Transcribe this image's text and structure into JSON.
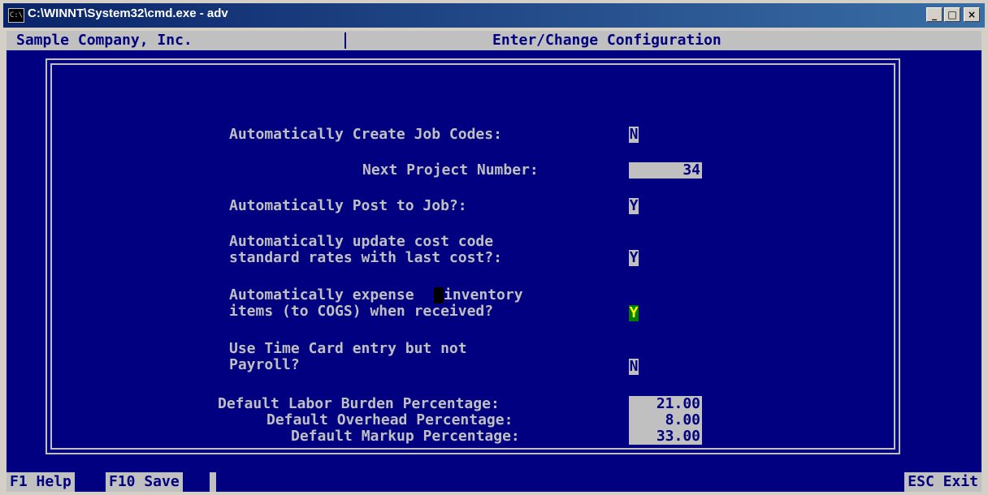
{
  "window": {
    "title": "C:\\WINNT\\System32\\cmd.exe - adv",
    "icon_text": "C:\\",
    "buttons": {
      "minimize": "_",
      "maximize": "□",
      "close": "×"
    }
  },
  "header": {
    "company": "Sample Company, Inc.",
    "screen_title": "Enter/Change Configuration"
  },
  "form": {
    "auto_create_job_codes": {
      "label": "Automatically Create Job Codes:",
      "value": "N"
    },
    "next_project_number": {
      "label": "Next Project Number:",
      "value": "34"
    },
    "auto_post_to_job": {
      "label": "Automatically Post to Job?:",
      "value": "Y"
    },
    "auto_update_cost_code": {
      "label_line1": "Automatically update cost code",
      "label_line2": "standard rates with last cost?:",
      "value": "Y"
    },
    "auto_expense_inventory": {
      "label_line1a": "Automatically expense",
      "label_line1b": "inventory",
      "label_line2": "items (to COGS) when received?",
      "value": "Y"
    },
    "use_time_card": {
      "label_line1": "Use Time Card entry but not",
      "label_line2": "Payroll?",
      "value": "N"
    },
    "labor_burden": {
      "label": "Default Labor Burden Percentage:",
      "value": "21.00"
    },
    "overhead": {
      "label": "Default Overhead Percentage:",
      "value": "8.00"
    },
    "markup": {
      "label": "Default Markup Percentage:",
      "value": "33.00"
    }
  },
  "footer": {
    "help": "F1 Help",
    "save": "F10 Save",
    "exit": "ESC Exit"
  },
  "colors": {
    "background": "#000080",
    "field": "#c0c0c0",
    "text": "#c0c0c0",
    "active_field": "#008000",
    "active_text": "#ffff00"
  }
}
